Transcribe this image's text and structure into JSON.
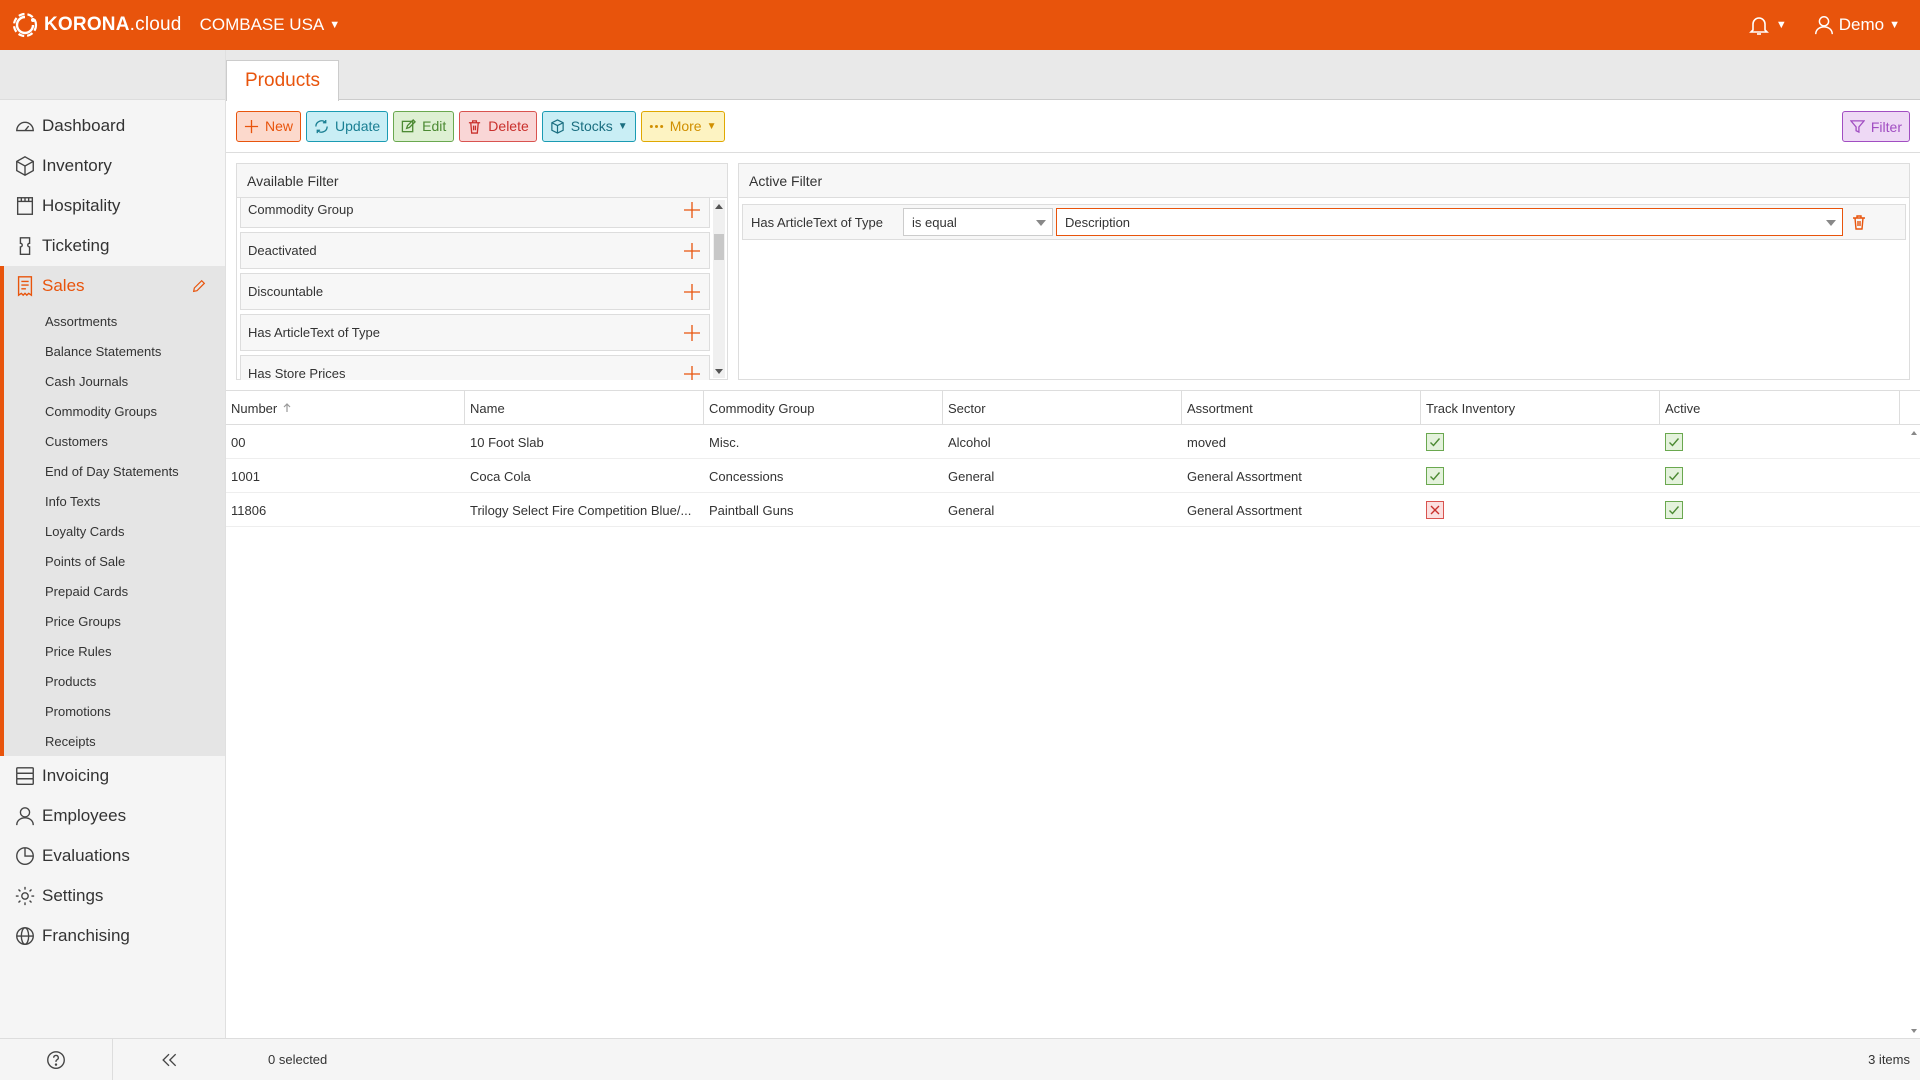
{
  "brand": {
    "name_bold": "KORONA",
    "name_light": ".cloud"
  },
  "company": {
    "name": "COMBASE USA"
  },
  "user": {
    "name": "Demo"
  },
  "sidebar": {
    "items": [
      {
        "label": "Dashboard",
        "icon": "dashboard-icon"
      },
      {
        "label": "Inventory",
        "icon": "box-icon"
      },
      {
        "label": "Hospitality",
        "icon": "calendar-icon"
      },
      {
        "label": "Ticketing",
        "icon": "ticket-icon"
      },
      {
        "label": "Sales",
        "icon": "receipt-icon"
      },
      {
        "label": "Invoicing",
        "icon": "server-icon"
      },
      {
        "label": "Employees",
        "icon": "user-icon"
      },
      {
        "label": "Evaluations",
        "icon": "pie-chart-icon"
      },
      {
        "label": "Settings",
        "icon": "gear-icon"
      },
      {
        "label": "Franchising",
        "icon": "globe-icon"
      }
    ],
    "sales_sub": [
      "Assortments",
      "Balance Statements",
      "Cash Journals",
      "Commodity Groups",
      "Customers",
      "End of Day Statements",
      "Info Texts",
      "Loyalty Cards",
      "Points of Sale",
      "Prepaid Cards",
      "Price Groups",
      "Price Rules",
      "Products",
      "Promotions",
      "Receipts"
    ]
  },
  "tab": {
    "label": "Products"
  },
  "toolbar": {
    "new_label": "New",
    "update_label": "Update",
    "edit_label": "Edit",
    "delete_label": "Delete",
    "stocks_label": "Stocks",
    "more_label": "More",
    "filter_label": "Filter"
  },
  "available_filter": {
    "title": "Available Filter",
    "items": [
      "Commodity Group",
      "Deactivated",
      "Discountable",
      "Has ArticleText of Type",
      "Has Store Prices"
    ]
  },
  "active_filter": {
    "title": "Active Filter",
    "field": "Has ArticleText of Type",
    "operator": "is equal",
    "value": "Description"
  },
  "table": {
    "columns": [
      "Number",
      "Name",
      "Commodity Group",
      "Sector",
      "Assortment",
      "Track Inventory",
      "Active"
    ],
    "rows": [
      {
        "number": "00",
        "name": "10 Foot Slab",
        "commodity_group": "Misc.",
        "sector": "Alcohol",
        "assortment": "moved",
        "track_inventory": true,
        "active": true
      },
      {
        "number": "1001",
        "name": "Coca Cola",
        "commodity_group": "Concessions",
        "sector": "General",
        "assortment": "General Assortment",
        "track_inventory": true,
        "active": true
      },
      {
        "number": "11806",
        "name": "Trilogy Select Fire Competition Blue/...",
        "commodity_group": "Paintball Guns",
        "sector": "General",
        "assortment": "General Assortment",
        "track_inventory": false,
        "active": true
      }
    ]
  },
  "status": {
    "selected": "0 selected",
    "items": "3 items"
  },
  "colors": {
    "brand": "#e8540c"
  }
}
